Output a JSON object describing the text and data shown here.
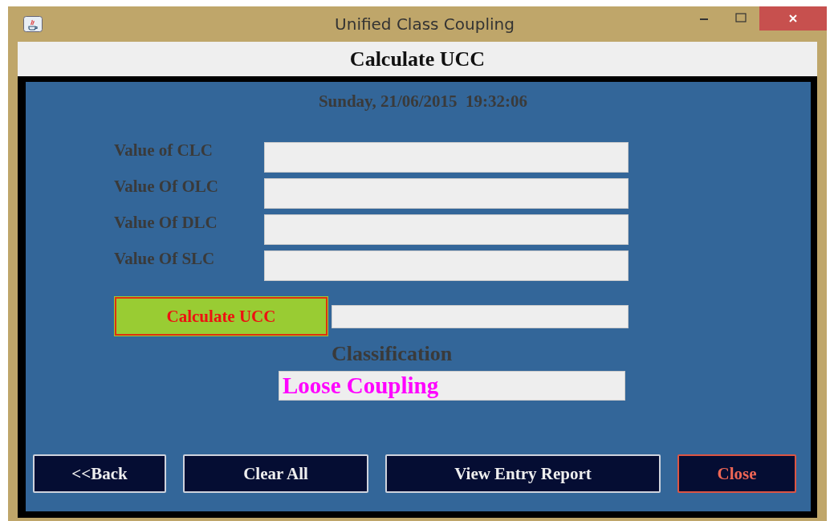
{
  "window": {
    "title": "Unified Class Coupling"
  },
  "header": {
    "title": "Calculate UCC"
  },
  "datetime": "Sunday, 21/06/2015  19:32:06",
  "fields": [
    {
      "label": "Value of CLC"
    },
    {
      "label": "Value Of OLC"
    },
    {
      "label": "Value Of DLC"
    },
    {
      "label": "Value Of SLC"
    }
  ],
  "calculate_button": "Calculate UCC",
  "classification": {
    "label": "Classification",
    "value": "Loose Coupling"
  },
  "buttons": [
    {
      "label": "<<Back",
      "kind": "normal"
    },
    {
      "label": "Clear All",
      "kind": "normal"
    },
    {
      "label": "View Entry Report",
      "kind": "normal"
    },
    {
      "label": "Close",
      "kind": "danger"
    }
  ]
}
